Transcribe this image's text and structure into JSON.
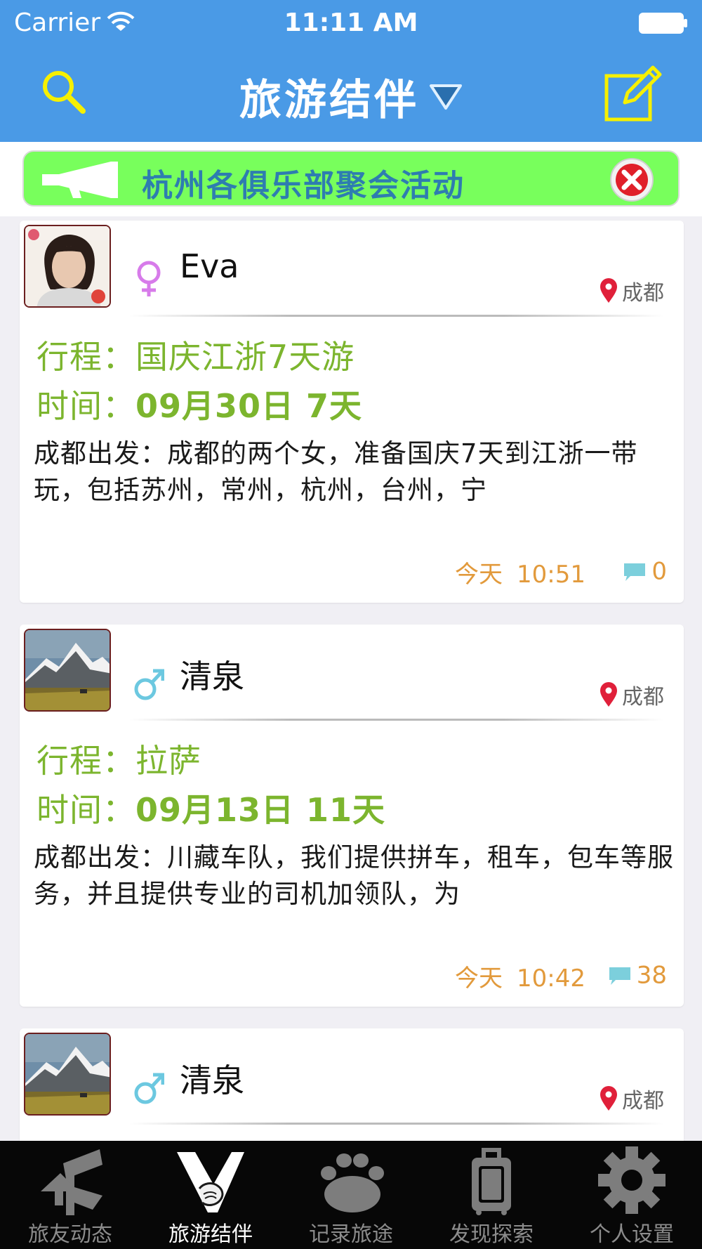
{
  "status_bar": {
    "carrier": "Carrier",
    "time": "11:11 AM"
  },
  "nav": {
    "title": "旅游结伴",
    "search_icon": "search-icon",
    "compose_icon": "compose-icon",
    "dropdown_icon": "triangle-down-icon",
    "bar_color": "#4a9ae6",
    "icon_color": "#f6f000"
  },
  "announcement": {
    "text": "杭州各俱乐部聚会活动",
    "background": "#78ff5c",
    "text_color": "#2e7db0"
  },
  "posts": [
    {
      "name": "Eva",
      "gender": "female",
      "gender_symbol": "♀",
      "location": "成都",
      "trip_label": "行程：",
      "trip": "国庆江浙7天游",
      "time_label": "时间：",
      "time": "09月30日 7天",
      "description": "成都出发：成都的两个女，准备国庆7天到江浙一带玩，包括苏州，常州，杭州，台州，宁",
      "posted_day": "今天",
      "posted_time": "10:51",
      "comments": "0"
    },
    {
      "name": "清泉",
      "gender": "male",
      "gender_symbol": "♂",
      "location": "成都",
      "trip_label": "行程：",
      "trip": "拉萨",
      "time_label": "时间：",
      "time": "09月13日 11天",
      "description": "成都出发：川藏车队，我们提供拼车，租车，包车等服务，并且提供专业的司机加领队，为",
      "posted_day": "今天",
      "posted_time": "10:42",
      "comments": "38"
    },
    {
      "name": "清泉",
      "gender": "male",
      "gender_symbol": "♂",
      "location": "成都"
    }
  ],
  "tabs": [
    {
      "label": "旅友动态",
      "icon": "signpost-icon",
      "active": false
    },
    {
      "label": "旅游结伴",
      "icon": "holding-hands-icon",
      "active": true
    },
    {
      "label": "记录旅途",
      "icon": "paw-print-icon",
      "active": false
    },
    {
      "label": "发现探索",
      "icon": "suitcase-icon",
      "active": false
    },
    {
      "label": "个人设置",
      "icon": "gear-icon",
      "active": false
    }
  ],
  "colors": {
    "green_text": "#7cb52e",
    "orange_text": "#e29a3c",
    "female": "#d77bea",
    "male": "#6cc8e0",
    "pin": "#e0203a"
  }
}
